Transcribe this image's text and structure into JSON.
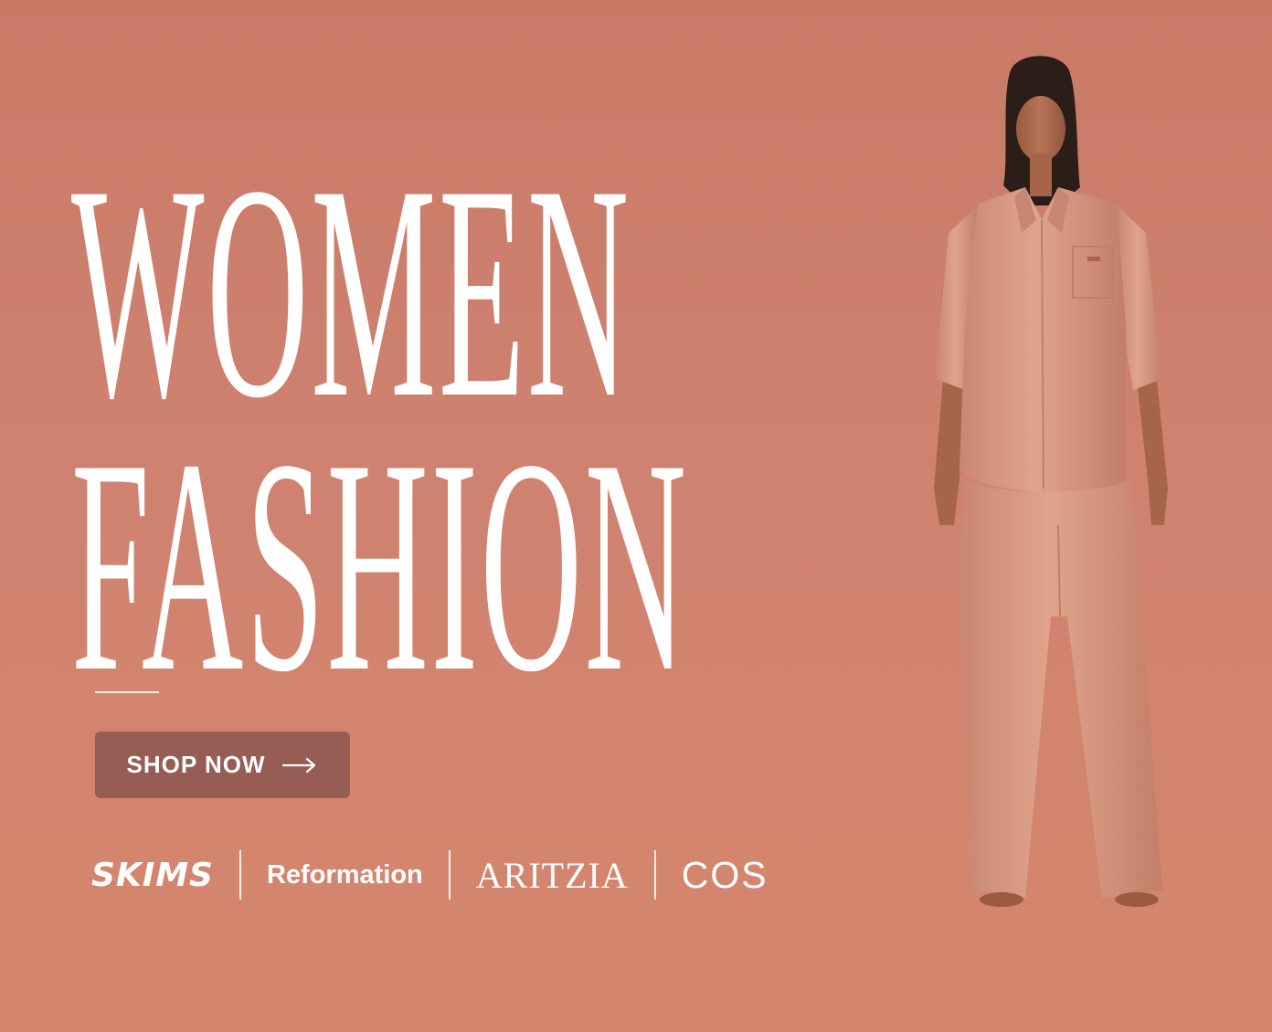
{
  "hero": {
    "title_line1": "WOMEN",
    "title_line2": "FASHION"
  },
  "cta": {
    "label": "SHOP NOW",
    "icon": "arrow-right-icon"
  },
  "brands": [
    {
      "name": "SKIMS"
    },
    {
      "name": "Reformation"
    },
    {
      "name": "ARITZIA"
    },
    {
      "name": "COS"
    }
  ],
  "colors": {
    "background": "#cf8270",
    "button": "#7e4e4a",
    "text": "#ffffff",
    "outfit": "#d99a84"
  }
}
